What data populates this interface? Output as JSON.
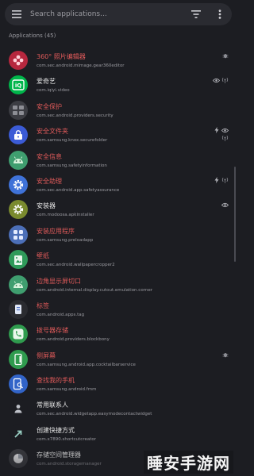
{
  "colors": {
    "disabled_red": "#e05a5a",
    "normal_text": "#e6e6e6",
    "bg": "#1c1d22"
  },
  "search": {
    "placeholder": "Search applications..."
  },
  "header": {
    "section_label": "Applications (45)"
  },
  "apps": [
    {
      "name": "360° 照片编辑器",
      "package": "com.sec.android.mimage.gear360editor",
      "disabled": true,
      "icon": "flower-icon",
      "icon_color": "#b6273e",
      "flags": [
        "bug-icon"
      ]
    },
    {
      "name": "爱奇艺",
      "package": "com.iqiyi.video",
      "disabled": false,
      "icon": "iqiyi-icon",
      "icon_color": "#00b54a",
      "flags": [
        "eye-icon",
        "antenna-icon"
      ]
    },
    {
      "name": "安全保护",
      "package": "com.sec.android.providers.security",
      "disabled": true,
      "icon": "grid-icon",
      "icon_color": "#3c3d43",
      "flags": []
    },
    {
      "name": "安全文件夹",
      "package": "com.samsung.knox.securefolder",
      "disabled": true,
      "icon": "folder-lock-icon",
      "icon_color": "#3b5bd6",
      "flags": [
        "bolt-icon",
        "eye-icon",
        "antenna-icon"
      ]
    },
    {
      "name": "安全信息",
      "package": "com.samsung.safetyinformation",
      "disabled": true,
      "icon": "android-icon",
      "icon_color": "#3f9e6f",
      "flags": []
    },
    {
      "name": "安全助理",
      "package": "com.sec.android.app.safetyassurance",
      "disabled": true,
      "icon": "gear-icon",
      "icon_color": "#3f72d8",
      "flags": [
        "bolt-icon",
        "antenna-icon"
      ]
    },
    {
      "name": "安装器",
      "package": "com.modoosa.apkinstaller",
      "disabled": false,
      "icon": "gear-icon",
      "icon_color": "#7a8a2e",
      "flags": [
        "eye-icon"
      ]
    },
    {
      "name": "安装应用程序",
      "package": "com.samsung.preloadapp",
      "disabled": true,
      "icon": "apps-icon",
      "icon_color": "#4c6fb8",
      "flags": []
    },
    {
      "name": "壁纸",
      "package": "com.sec.android.wallpapercropper2",
      "disabled": true,
      "icon": "wallpaper-icon",
      "icon_color": "#2f9a5a",
      "flags": []
    },
    {
      "name": "边角显示屏切口",
      "package": "com.android.internal.display.cutout.emulation.corner",
      "disabled": true,
      "icon": "android-icon",
      "icon_color": "#3f9e6f",
      "flags": []
    },
    {
      "name": "标签",
      "package": "com.android.apps.tag",
      "disabled": true,
      "icon": "tag-icon",
      "icon_color": "#2a2b30",
      "flags": []
    },
    {
      "name": "拨号器存储",
      "package": "com.android.providers.blockbony",
      "disabled": true,
      "icon": "phone-icon",
      "icon_color": "#2f9b4e",
      "flags": []
    },
    {
      "name": "侧屏幕",
      "package": "com.samsung.android.app.cocktailbarservice",
      "disabled": true,
      "icon": "edge-panel-icon",
      "icon_color": "#2f9b4e",
      "flags": [
        "bug-icon"
      ]
    },
    {
      "name": "查找我的手机",
      "package": "com.samsung.android.fmm",
      "disabled": true,
      "icon": "find-phone-icon",
      "icon_color": "#3264c8",
      "flags": []
    },
    {
      "name": "常用联系人",
      "package": "com.sec.android.widgetapp.easymodecontactwidget",
      "disabled": false,
      "icon": "person-icon",
      "icon_color": "#1c1d22",
      "flags": []
    },
    {
      "name": "创建快捷方式",
      "package": "com.x7890.shortcutcreator",
      "disabled": false,
      "icon": "shortcut-icon",
      "icon_color": "#1c1d22",
      "flags": []
    },
    {
      "name": "存储空间管理器",
      "package": "com.android.storagemanager",
      "disabled": false,
      "icon": "storage-icon",
      "icon_color": "#3a3b40",
      "flags": []
    }
  ],
  "watermark": {
    "text": "睡安手游网"
  }
}
